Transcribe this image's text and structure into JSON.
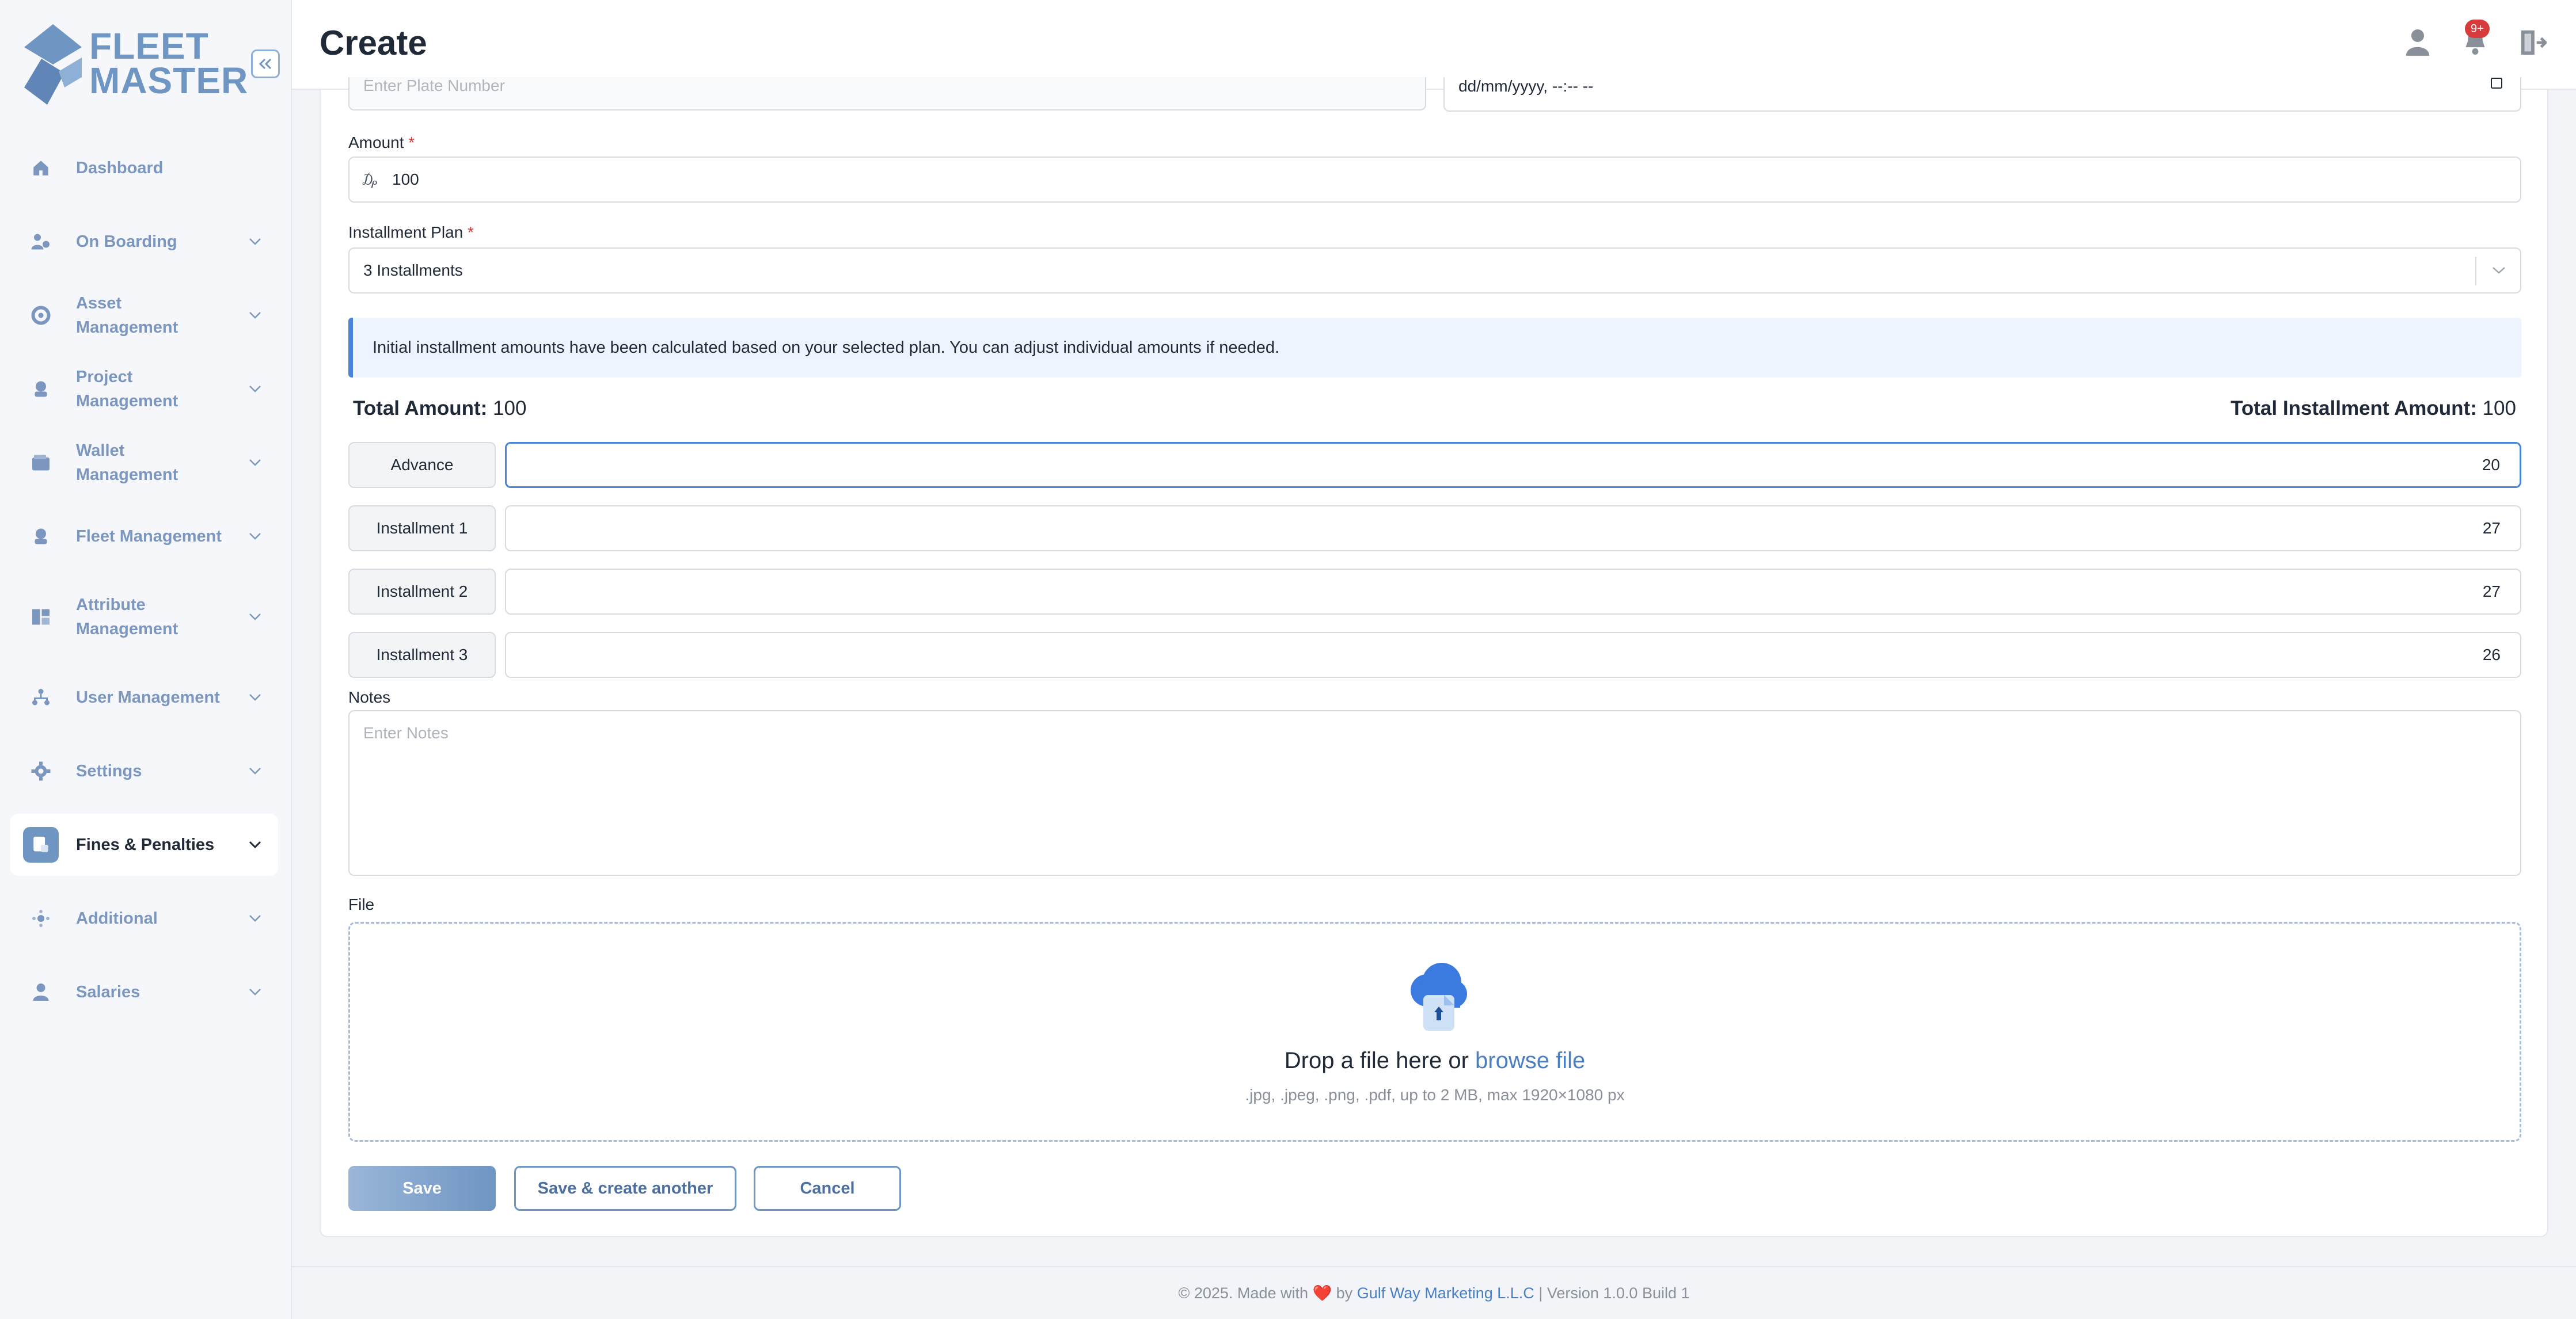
{
  "app": {
    "logo_line1": "FLEET",
    "logo_line2": "MASTER",
    "brand_color": "#6f95c2"
  },
  "sidebar": {
    "items": [
      {
        "label": "Dashboard",
        "icon": "home-icon"
      },
      {
        "label": "On Boarding",
        "icon": "user-onboard-icon"
      },
      {
        "label": "Asset Management",
        "icon": "asset-icon"
      },
      {
        "label": "Project Management",
        "icon": "project-icon"
      },
      {
        "label": "Wallet Management",
        "icon": "wallet-icon"
      },
      {
        "label": "Fleet Management",
        "icon": "fleet-icon"
      },
      {
        "label": "Attribute Management",
        "icon": "attribute-icon"
      },
      {
        "label": "User Management",
        "icon": "users-icon"
      },
      {
        "label": "Settings",
        "icon": "gear-icon"
      },
      {
        "label": "Fines & Penalties",
        "icon": "fines-icon",
        "active": true
      },
      {
        "label": "Additional",
        "icon": "additional-icon"
      },
      {
        "label": "Salaries",
        "icon": "salaries-icon"
      }
    ]
  },
  "header": {
    "title": "Create",
    "notification_badge": "9+"
  },
  "form": {
    "plate_placeholder": "Enter Plate Number",
    "datetime_placeholder": "dd/mm/yyyy, --:-- --",
    "amount_label": "Amount",
    "amount_currency": "₯",
    "amount_value": "100",
    "plan_label": "Installment Plan",
    "plan_value": "3 Installments",
    "info_text": "Initial installment amounts have been calculated based on your selected plan. You can adjust individual amounts if needed.",
    "total_amount_label": "Total Amount:",
    "total_amount_value": "100",
    "total_installment_label": "Total Installment Amount:",
    "total_installment_value": "100",
    "installments": [
      {
        "label": "Advance",
        "value": "20"
      },
      {
        "label": "Installment 1",
        "value": "27"
      },
      {
        "label": "Installment 2",
        "value": "27"
      },
      {
        "label": "Installment 3",
        "value": "26"
      }
    ],
    "notes_label": "Notes",
    "notes_placeholder": "Enter Notes",
    "file_label": "File",
    "drop_text": "Drop a file here or",
    "browse_text": "browse file",
    "file_hint": ".jpg, .jpeg, .png, .pdf, up to 2 MB, max 1920×1080 px",
    "required_mark": "*"
  },
  "actions": {
    "save": "Save",
    "save_another": "Save & create another",
    "cancel": "Cancel"
  },
  "footer": {
    "prefix": "© 2025. Made with",
    "heart": "❤️",
    "by": "by",
    "company": "Gulf Way Marketing L.L.C",
    "version": "| Version 1.0.0 Build 1"
  }
}
